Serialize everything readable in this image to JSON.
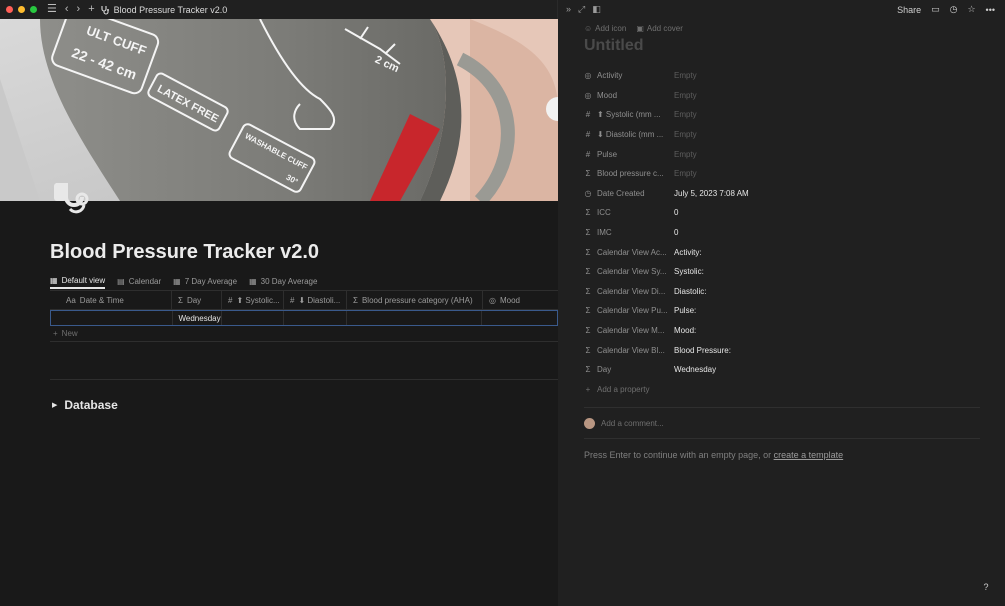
{
  "titlebar": {
    "title": "Blood Pressure Tracker v2.0",
    "lights": [
      "#ff5f57",
      "#febc2e",
      "#28c840"
    ],
    "icons": [
      "menu-icon",
      "back-icon",
      "forward-icon",
      "plus-icon",
      "stethoscope-icon"
    ]
  },
  "cover": {
    "labels": {
      "cuff": "ULT CUFF",
      "size": "22 - 42 cm",
      "latex": "LATEX FREE",
      "washable": "WASHABLE CUFF",
      "temp": "30°",
      "measure": "2 cm"
    }
  },
  "page": {
    "title": "Blood Pressure Tracker v2.0",
    "views": [
      {
        "label": "Default view",
        "icon": "table-icon"
      },
      {
        "label": "Calendar",
        "icon": "calendar-icon"
      },
      {
        "label": "7 Day Average",
        "icon": "table-icon"
      },
      {
        "label": "30 Day Average",
        "icon": "table-icon"
      }
    ],
    "columns": [
      {
        "label": "Date & Time",
        "icon": "Aa"
      },
      {
        "label": "Day",
        "icon": "Σ"
      },
      {
        "label": "⬆ Systolic...",
        "icon": "#"
      },
      {
        "label": "⬇ Diastoli...",
        "icon": "#"
      },
      {
        "label": "Blood pressure category (AHA)",
        "icon": "Σ"
      },
      {
        "label": "Mood",
        "icon": "◎"
      }
    ],
    "row": {
      "day": "Wednesday"
    },
    "new_label": "New",
    "database_label": "Database"
  },
  "peek": {
    "share_label": "Share",
    "add_icon_label": "Add icon",
    "add_cover_label": "Add cover",
    "title_placeholder": "Untitled",
    "properties": [
      {
        "icon": "◎",
        "name": "Activity",
        "value": "Empty",
        "empty": true
      },
      {
        "icon": "◎",
        "name": "Mood",
        "value": "Empty",
        "empty": true
      },
      {
        "icon": "#",
        "name": "⬆ Systolic (mm ...",
        "value": "Empty",
        "empty": true
      },
      {
        "icon": "#",
        "name": "⬇ Diastolic (mm ...",
        "value": "Empty",
        "empty": true
      },
      {
        "icon": "#",
        "name": "Pulse",
        "value": "Empty",
        "empty": true
      },
      {
        "icon": "Σ",
        "name": "Blood pressure c...",
        "value": "Empty",
        "empty": true
      },
      {
        "icon": "◷",
        "name": "Date Created",
        "value": "July 5, 2023 7:08 AM",
        "empty": false
      },
      {
        "icon": "Σ",
        "name": "ICC",
        "value": "0",
        "empty": false
      },
      {
        "icon": "Σ",
        "name": "IMC",
        "value": "0",
        "empty": false
      },
      {
        "icon": "Σ",
        "name": "Calendar View Ac...",
        "value": "Activity:",
        "empty": false
      },
      {
        "icon": "Σ",
        "name": "Calendar View Sy...",
        "value": "Systolic:",
        "empty": false
      },
      {
        "icon": "Σ",
        "name": "Calendar View Di...",
        "value": "Diastolic:",
        "empty": false
      },
      {
        "icon": "Σ",
        "name": "Calendar View Pu...",
        "value": "Pulse:",
        "empty": false
      },
      {
        "icon": "Σ",
        "name": "Calendar View M...",
        "value": "Mood:",
        "empty": false
      },
      {
        "icon": "Σ",
        "name": "Calendar View Bl...",
        "value": "Blood Pressure:",
        "empty": false
      },
      {
        "icon": "Σ",
        "name": "Day",
        "value": "Wednesday",
        "empty": false
      }
    ],
    "add_property_label": "Add a property",
    "comment_placeholder": "Add a comment...",
    "hint_text": "Press Enter to continue with an empty page, or ",
    "hint_link": "create a template",
    "help_label": "?"
  }
}
